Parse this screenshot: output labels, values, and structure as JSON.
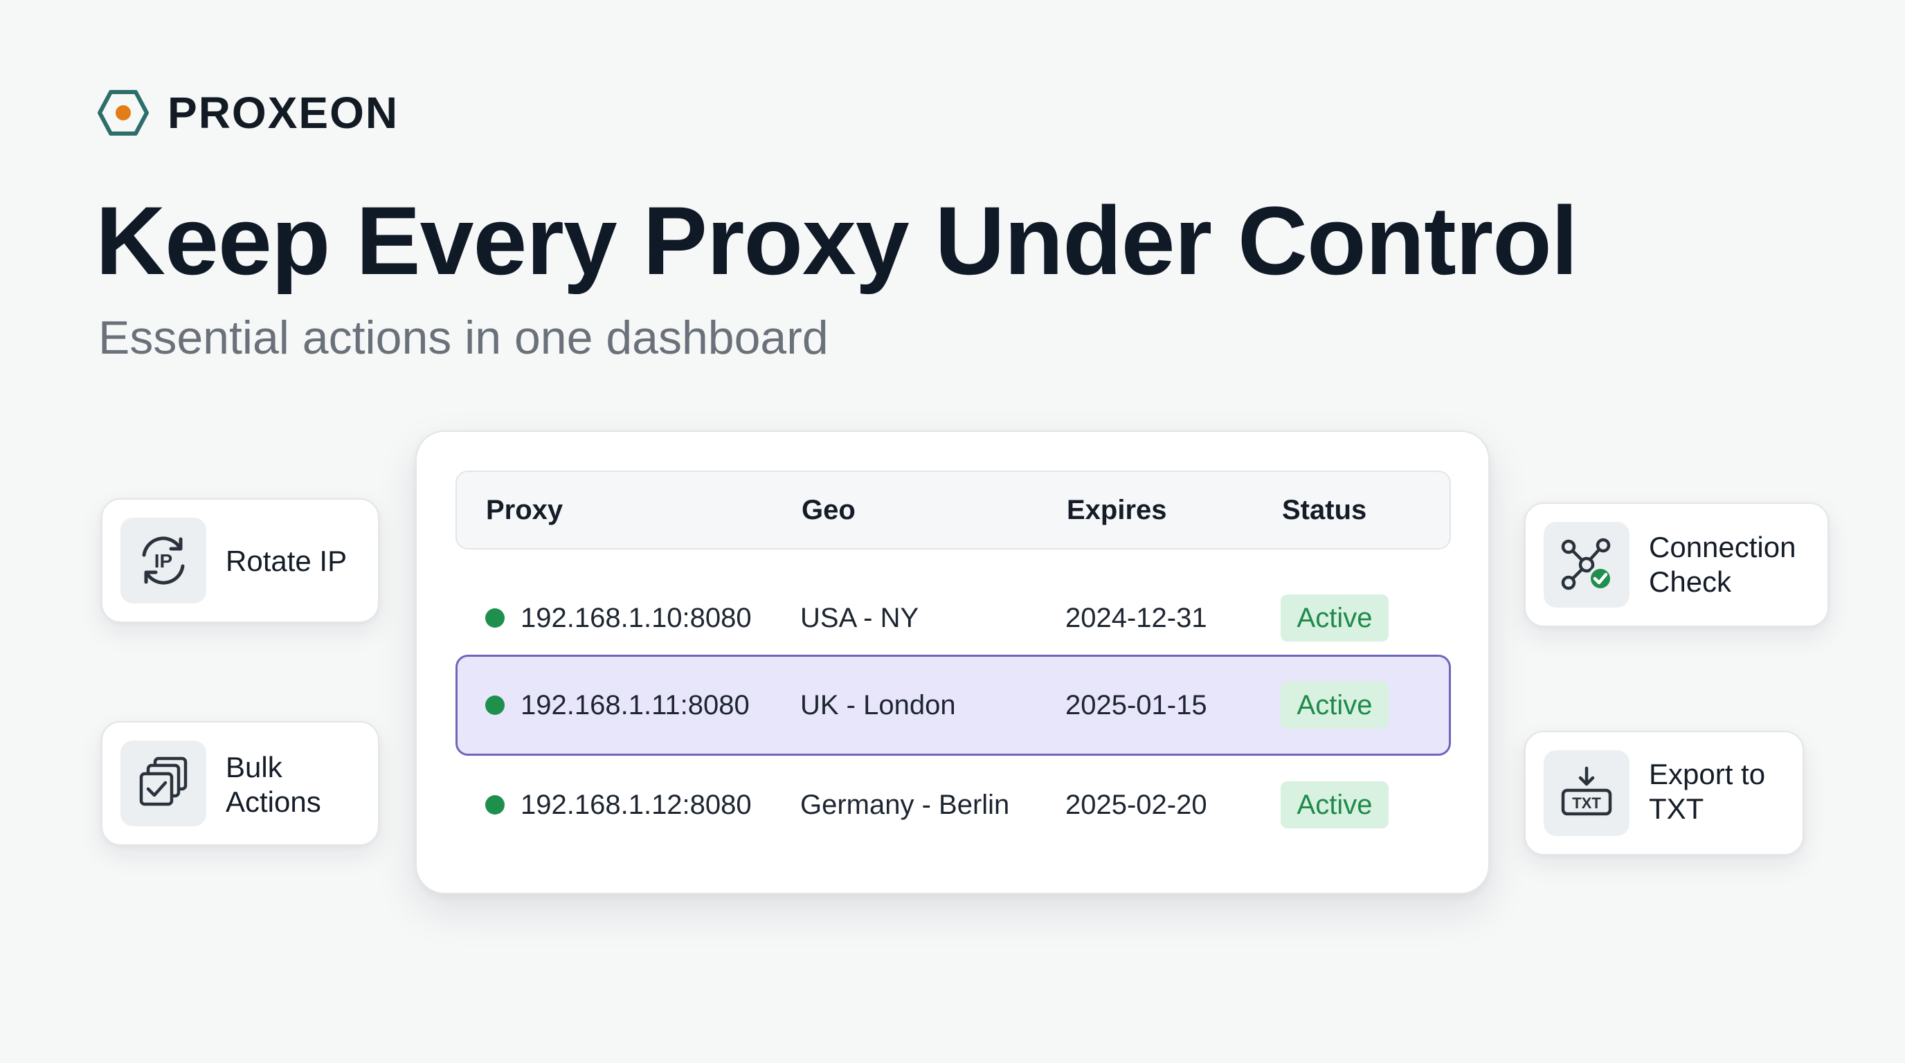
{
  "brand": {
    "name": "PROXEON",
    "logo_icon": "hexagon-dot-icon",
    "colors": {
      "teal": "#2c6f6a",
      "orange": "#e27d17"
    }
  },
  "hero": {
    "title": "Keep Every Proxy Under Control",
    "subtitle": "Essential actions in one dashboard"
  },
  "table": {
    "columns": [
      "Proxy",
      "Geo",
      "Expires",
      "Status"
    ],
    "rows": [
      {
        "proxy": "192.168.1.10:8080",
        "geo": "USA - NY",
        "expires": "2024-12-31",
        "status": "Active",
        "selected": false
      },
      {
        "proxy": "192.168.1.11:8080",
        "geo": "UK - London",
        "expires": "2025-01-15",
        "status": "Active",
        "selected": true
      },
      {
        "proxy": "192.168.1.12:8080",
        "geo": "Germany - Berlin",
        "expires": "2025-02-20",
        "status": "Active",
        "selected": false
      }
    ],
    "colors": {
      "status_dot": "#1f8f4e",
      "active_badge_bg": "#d8f1e0",
      "active_badge_text": "#1f8a4b",
      "selected_row_bg": "#e8e6fa",
      "selected_row_border": "#6e65bb"
    }
  },
  "actions": {
    "rotate_ip": {
      "label": "Rotate IP",
      "icon": "rotate-ip-icon",
      "icon_text": "IP"
    },
    "bulk_actions": {
      "label": "Bulk\nActions",
      "icon": "bulk-actions-icon"
    },
    "connection_check": {
      "label": "Connection\nCheck",
      "icon": "connection-check-icon"
    },
    "export_txt": {
      "label": "Export to\nTXT",
      "icon": "export-txt-icon",
      "icon_text": "TXT"
    }
  }
}
